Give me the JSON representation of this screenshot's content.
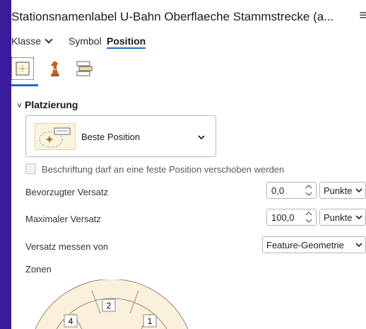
{
  "title": "Stationsnamenlabel U-Bahn Oberflaeche Stammstrecke (a...",
  "tabs": [
    {
      "label": "Klasse",
      "has_dropdown": true
    },
    {
      "label": "Symbol"
    },
    {
      "label": "Position",
      "active": true
    }
  ],
  "subtabs": [
    {
      "icon": "position-icon",
      "active": true
    },
    {
      "icon": "conflict-resolution-icon"
    },
    {
      "icon": "fitting-strategy-icon"
    }
  ],
  "section": {
    "title": "Platzierung",
    "expanded": true
  },
  "placement": {
    "selected": "Beste Position"
  },
  "checkbox": {
    "label": "Beschriftung darf an eine feste Position verschoben werden",
    "checked": false,
    "enabled": false
  },
  "preferred_offset": {
    "label": "Bevorzugter Versatz",
    "value": "0,0",
    "unit": "Punkte"
  },
  "max_offset": {
    "label": "Maximaler Versatz",
    "value": "100,0",
    "unit": "Punkte"
  },
  "measure_from": {
    "label": "Versatz messen von",
    "value": "Feature-Geometrie"
  },
  "zones": {
    "label": "Zonen",
    "numbers": [
      "2",
      "4",
      "1"
    ]
  },
  "colors": {
    "accent": "#1f6bd1",
    "window_bg": "#3a1a9c"
  }
}
